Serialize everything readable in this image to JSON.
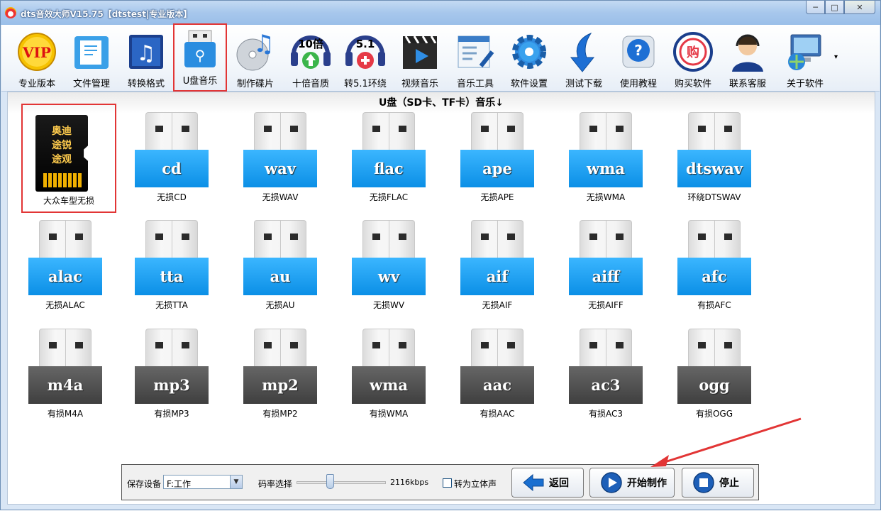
{
  "window": {
    "title": "dts音效大师V15.75【dtstest|专业版本】",
    "controls": {
      "minimize": "─",
      "maximize": "□",
      "close": "✕"
    }
  },
  "toolbar": {
    "items": [
      {
        "label": "专业版本",
        "icon": "vip-icon",
        "badge": "VIP"
      },
      {
        "label": "文件管理",
        "icon": "file-manage-icon"
      },
      {
        "label": "转换格式",
        "icon": "convert-format-icon"
      },
      {
        "label": "U盘音乐",
        "icon": "usb-music-icon",
        "selected": true
      },
      {
        "label": "制作碟片",
        "icon": "make-disc-icon"
      },
      {
        "label": "十倍音质",
        "icon": "ten-times-quality-icon",
        "badge": "10倍"
      },
      {
        "label": "转5.1环绕",
        "icon": "surround-51-icon",
        "badge": "5.1"
      },
      {
        "label": "视频音乐",
        "icon": "video-music-icon"
      },
      {
        "label": "音乐工具",
        "icon": "music-tools-icon"
      },
      {
        "label": "软件设置",
        "icon": "settings-gear-icon"
      },
      {
        "label": "测试下载",
        "icon": "test-download-icon"
      },
      {
        "label": "使用教程",
        "icon": "help-tutorial-icon"
      },
      {
        "label": "购买软件",
        "icon": "buy-software-icon",
        "badge": "购"
      },
      {
        "label": "联系客服",
        "icon": "customer-service-icon"
      },
      {
        "label": "关于软件",
        "icon": "about-software-icon"
      }
    ],
    "more": "▾"
  },
  "content": {
    "title": "U盘（SD卡、TF卡）音乐↓",
    "formats": [
      {
        "label": "大众车型无损",
        "type": "sdcard",
        "card_text": [
          "奥迪",
          "途锐",
          "途观"
        ],
        "selected": true
      },
      {
        "label": "无损CD",
        "tag": "cd",
        "style": "blue"
      },
      {
        "label": "无损WAV",
        "tag": "wav",
        "style": "blue"
      },
      {
        "label": "无损FLAC",
        "tag": "flac",
        "style": "blue"
      },
      {
        "label": "无损APE",
        "tag": "ape",
        "style": "blue"
      },
      {
        "label": "无损WMA",
        "tag": "wma",
        "style": "blue"
      },
      {
        "label": "环绕DTSWAV",
        "tag": "dtswav",
        "style": "blue"
      },
      {
        "label": "无损ALAC",
        "tag": "alac",
        "style": "blue"
      },
      {
        "label": "无损TTA",
        "tag": "tta",
        "style": "blue"
      },
      {
        "label": "无损AU",
        "tag": "au",
        "style": "blue"
      },
      {
        "label": "无损WV",
        "tag": "wv",
        "style": "blue"
      },
      {
        "label": "无损AIF",
        "tag": "aif",
        "style": "blue"
      },
      {
        "label": "无损AIFF",
        "tag": "aiff",
        "style": "blue"
      },
      {
        "label": "有损AFC",
        "tag": "afc",
        "style": "blue"
      },
      {
        "label": "有损M4A",
        "tag": "m4a",
        "style": "gray"
      },
      {
        "label": "有损MP3",
        "tag": "mp3",
        "style": "gray"
      },
      {
        "label": "有损MP2",
        "tag": "mp2",
        "style": "gray"
      },
      {
        "label": "有损WMA",
        "tag": "wma",
        "style": "gray"
      },
      {
        "label": "有损AAC",
        "tag": "aac",
        "style": "gray"
      },
      {
        "label": "有损AC3",
        "tag": "ac3",
        "style": "gray"
      },
      {
        "label": "有损OGG",
        "tag": "ogg",
        "style": "gray"
      }
    ]
  },
  "bottom": {
    "save_device_label": "保存设备",
    "save_device_value": "F:工作",
    "bitrate_label": "码率选择",
    "bitrate_value": "2116kbps",
    "bitrate_fraction": 0.37,
    "stereo_label": "转为立体声",
    "stereo_checked": false,
    "back_label": "返回",
    "start_label": "开始制作",
    "stop_label": "停止"
  },
  "colors": {
    "lossless_blue": "#0b8fe6",
    "lossy_gray": "#3f3f3f",
    "highlight_red": "#e23535",
    "arrow_red": "#e23535"
  }
}
